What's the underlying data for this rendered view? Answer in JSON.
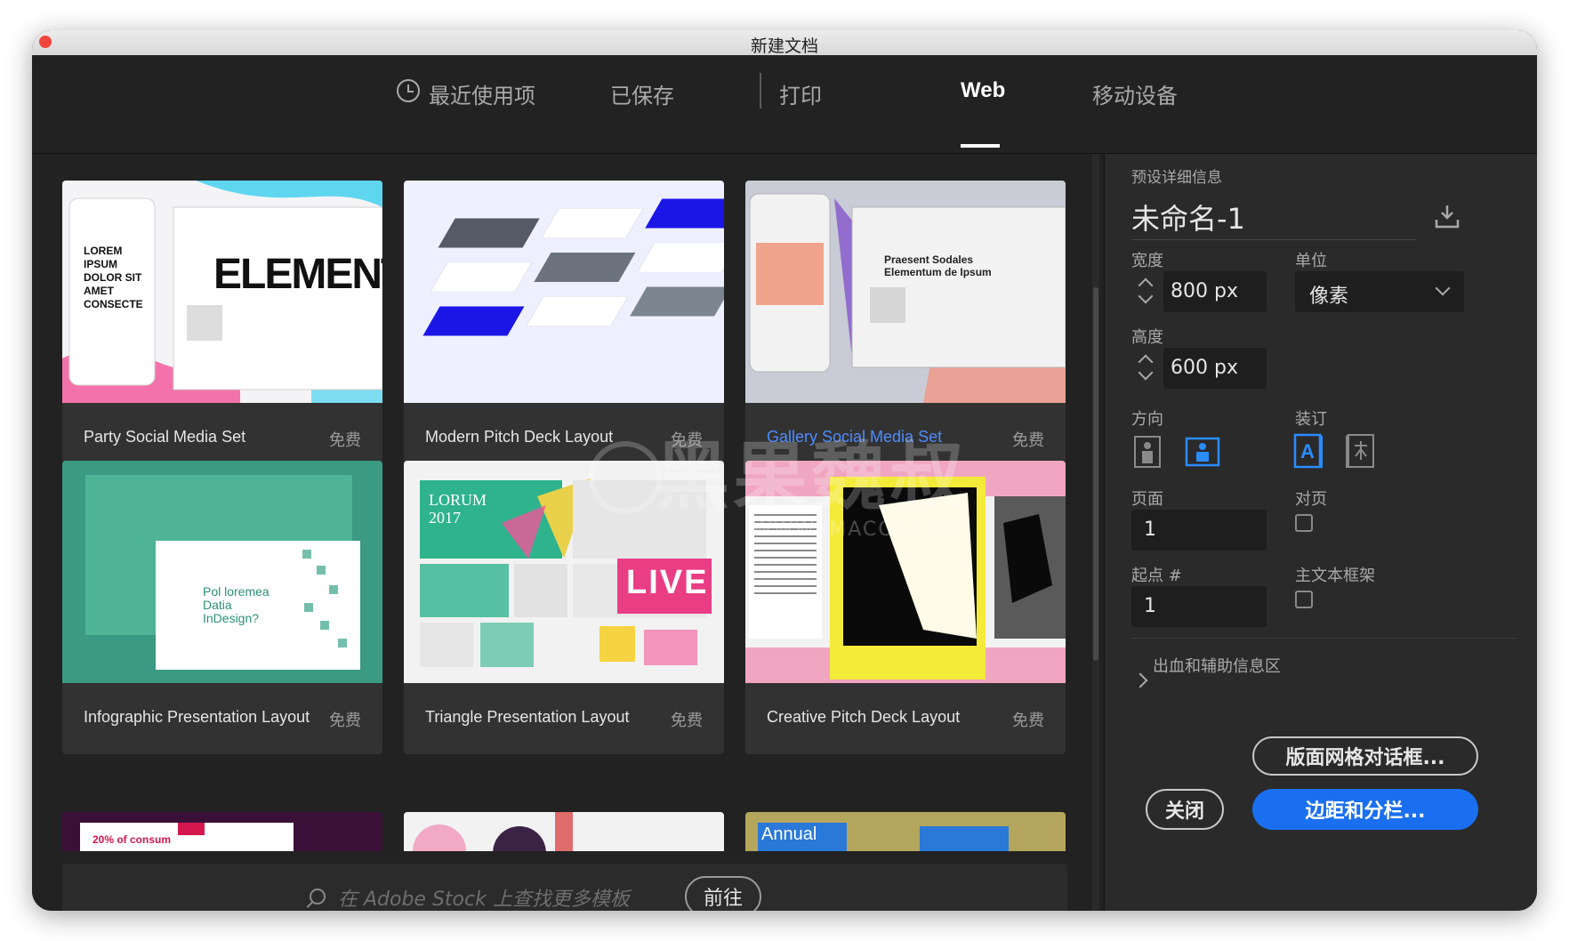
{
  "window": {
    "title": "新建文档"
  },
  "tabs": [
    {
      "label": "最近使用项"
    },
    {
      "label": "已保存"
    },
    {
      "label": "打印"
    },
    {
      "label": "Web"
    },
    {
      "label": "移动设备"
    }
  ],
  "templates": [
    {
      "name": "Party Social Media Set",
      "price": "免费",
      "thumb_title": "ELEMENTU",
      "thumb_text": "LOREM IPSUM DOLOR SIT AMET CONSECTE"
    },
    {
      "name": "Modern Pitch Deck Layout",
      "price": "免费"
    },
    {
      "name": "Gallery Social Media Set",
      "price": "免费",
      "thumb_title": "Praesent Sodales Elementum de Ipsum"
    },
    {
      "name": "Infographic Presentation Layout",
      "price": "免费",
      "thumb_title": "Pol loremea Datia InDesign?"
    },
    {
      "name": "Triangle Presentation Layout",
      "price": "免费",
      "thumb_title": "LORUM 2017",
      "thumb_badge": "LIVE"
    },
    {
      "name": "Creative Pitch Deck Layout",
      "price": "免费"
    }
  ],
  "partial_row": {
    "thumb_1_text": "20% of consum",
    "thumb_3_text": "Annual"
  },
  "stock_search": {
    "placeholder": "在 Adobe Stock 上查找更多模板",
    "go_label": "前往"
  },
  "preset": {
    "section_label": "预设详细信息",
    "doc_name": "未命名-1",
    "width_label": "宽度",
    "width_value": "800 px",
    "unit_label": "单位",
    "unit_value": "像素",
    "height_label": "高度",
    "height_value": "600 px",
    "orientation_label": "方向",
    "binding_label": "装订",
    "pages_label": "页面",
    "pages_value": "1",
    "facing_label": "对页",
    "start_label": "起点 #",
    "start_value": "1",
    "primary_frame_label": "主文本框架",
    "bleed_label": "出血和辅助信息区"
  },
  "buttons": {
    "layout_grid": "版面网格对话框...",
    "close": "关闭",
    "margins": "边距和分栏..."
  },
  "watermark": {
    "title": "黑果魏叔",
    "url": "WWW.IMACOSX.CN"
  },
  "colors": {
    "accent": "#1a6ff0",
    "panel_bg": "#2a2a2a",
    "link": "#4e8cff"
  }
}
